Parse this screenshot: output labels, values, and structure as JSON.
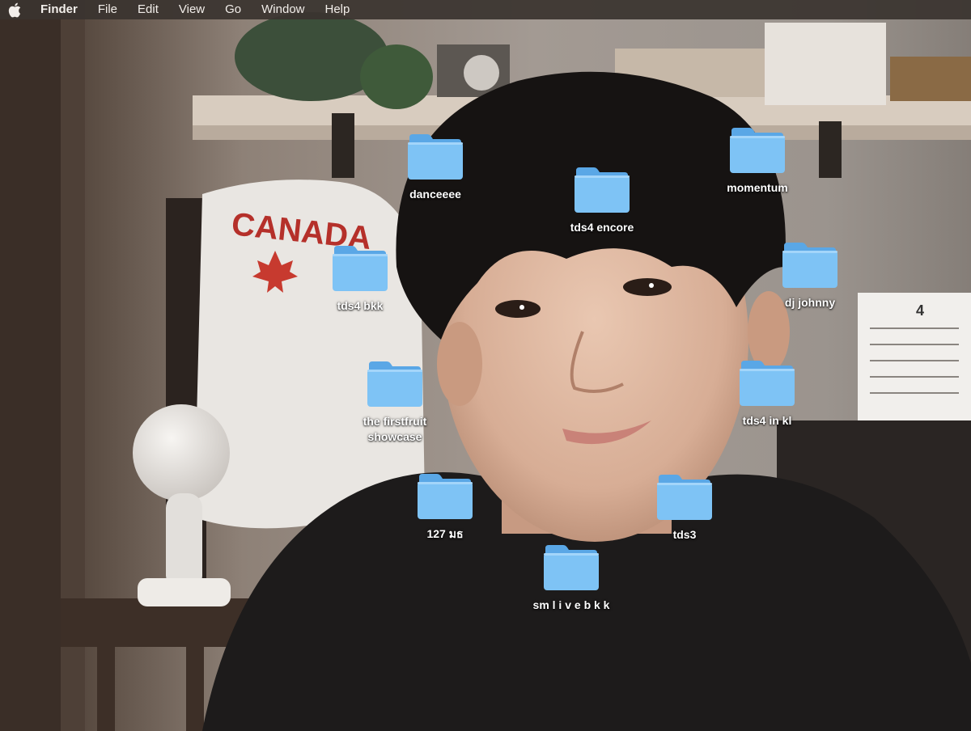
{
  "menubar": {
    "apple_icon": "apple-logo-icon",
    "app_name": "Finder",
    "items": [
      "File",
      "Edit",
      "View",
      "Go",
      "Window",
      "Help"
    ]
  },
  "desktop": {
    "folder_icon": "folder-icon",
    "folder_color": "#7ec3f5",
    "folders": [
      {
        "label": "danceeee"
      },
      {
        "label": "tds4 encore"
      },
      {
        "label": "momentum"
      },
      {
        "label": "tds4 bkk"
      },
      {
        "label": "dj johnny"
      },
      {
        "label": "the firstfruit\nshowcase"
      },
      {
        "label": "tds4 in kl"
      },
      {
        "label": "127 มธ"
      },
      {
        "label": "tds3"
      },
      {
        "label": "sm l i v e b k k"
      }
    ]
  },
  "wallpaper": {
    "sweatshirt_text": "CANADA",
    "calendar_month": "4"
  }
}
